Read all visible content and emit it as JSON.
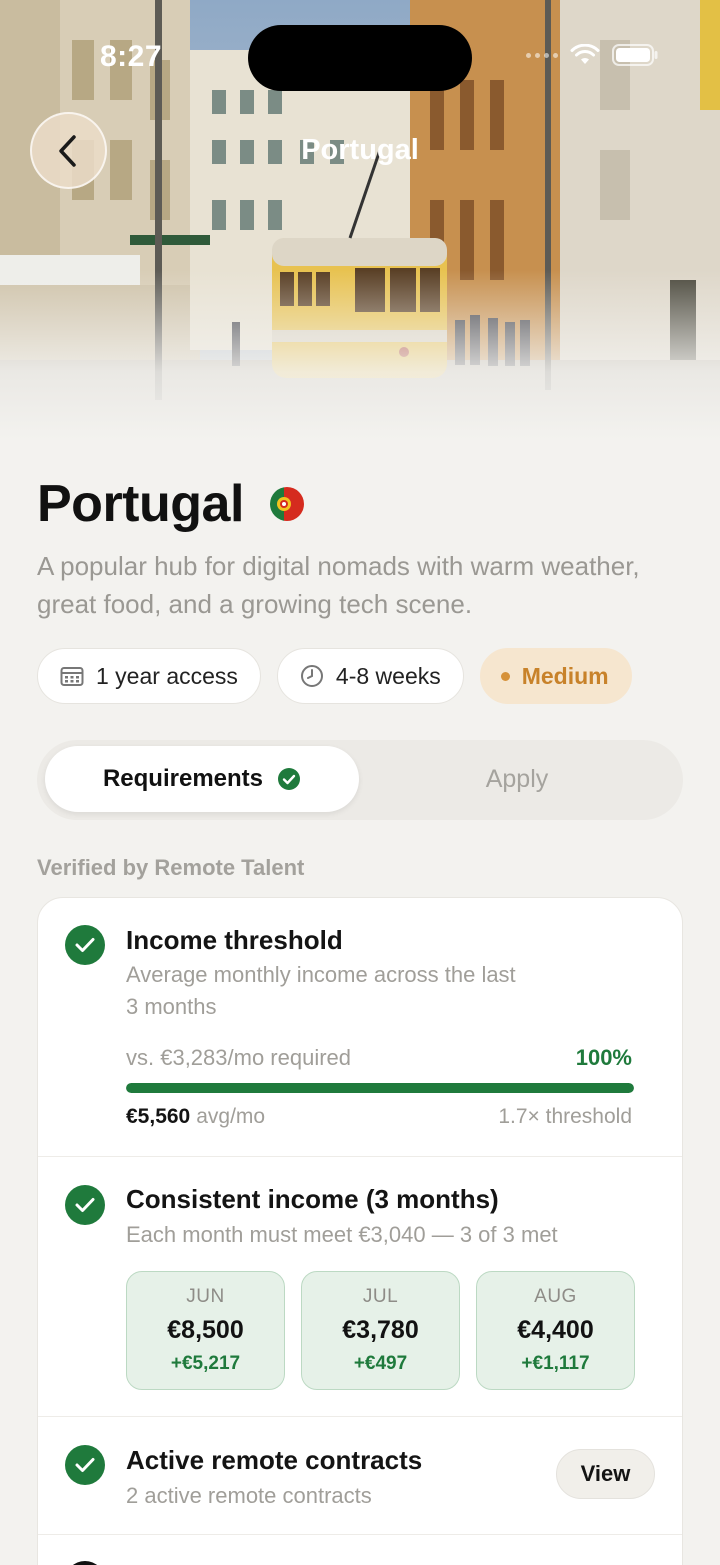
{
  "status": {
    "time": "8:27"
  },
  "nav": {
    "title": "Portugal",
    "back_icon": "chevron-left-icon"
  },
  "header": {
    "title": "Portugal",
    "flag": "portugal-flag-icon",
    "description": "A popular hub for digital nomads with warm weather, great food, and a growing tech scene."
  },
  "chips": {
    "access": {
      "icon": "calendar-icon",
      "label": "1 year access"
    },
    "duration": {
      "icon": "clock-icon",
      "label": "4-8 weeks"
    },
    "difficulty": {
      "label": "Medium",
      "color": "#c8822a"
    }
  },
  "tabs": {
    "requirements": "Requirements",
    "apply": "Apply"
  },
  "section_label": "Verified by Remote Talent",
  "requirements": {
    "income": {
      "title": "Income threshold",
      "subtitle_line1": "Average monthly income across the last",
      "subtitle_line2": "3 months",
      "vs_label": "vs. €3,283/mo required",
      "percent_label": "100%",
      "progress_fraction": 1.0,
      "avg_value": "€5,560",
      "avg_unit": "avg/mo",
      "threshold_ratio": "1.7× threshold"
    },
    "consistent": {
      "title": "Consistent income (3 months)",
      "subtitle": "Each month must meet €3,040 — 3 of 3 met",
      "months": [
        {
          "name": "JUN",
          "value": "€8,500",
          "diff": "+€5,217"
        },
        {
          "name": "JUL",
          "value": "€3,780",
          "diff": "+€497"
        },
        {
          "name": "AUG",
          "value": "€4,400",
          "diff": "+€1,117"
        }
      ]
    },
    "contracts": {
      "title": "Active remote contracts",
      "subtitle": "2 active remote contracts",
      "view_label": "View"
    }
  },
  "colors": {
    "accent_green": "#1f7a3c",
    "background": "#f3f2ef"
  }
}
